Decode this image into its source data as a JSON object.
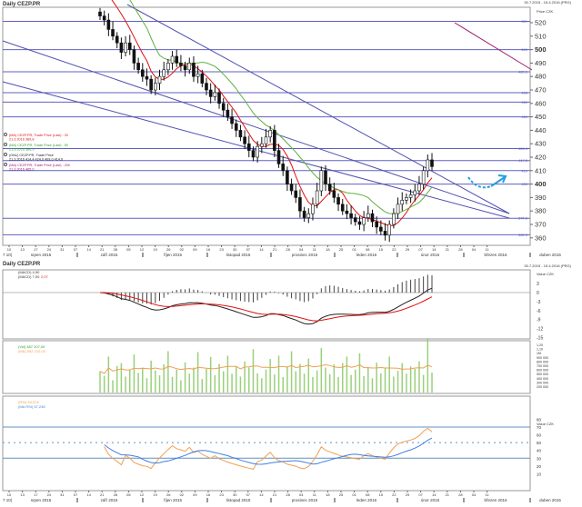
{
  "header": {
    "title": "Daily CEZP.PR",
    "date_range": "30.7.2015 - 15.4.2016 (PRG)",
    "axis_unit": "Price CZK"
  },
  "legend": [
    {
      "text": "(MA) CEZP.PR, Trade Price (Last) : 20",
      "sub": "21.3.2016  389,8",
      "color": "#e01010"
    },
    {
      "text": "(MA) CEZP.PR, Trade Price (Last) : 50",
      "sub": "21.3.2016  386,9",
      "color": "#30a030"
    },
    {
      "text": "(Ohlc) CEZP.PR, Trade Price",
      "sub": "21.3.2016  414,4  424,0  409,0  414,0",
      "color": "#202020"
    },
    {
      "text": "(MA) CEZP.PR, Trade Price (Last) : 200",
      "sub": "21.3.2016  465,0",
      "color": "#a02070"
    }
  ],
  "macd_legend": {
    "line1": "(MACD) 4,90",
    "line2": "(MACD) 7,00",
    "line2_val": "2,07"
  },
  "volume_legend": {
    "line1": "(Vol) 487 207,00",
    "line2": "(MA) 552 222,00"
  },
  "rsi_legend": {
    "line1": "(RSI) 64,578",
    "line2": "(MA RSI) 57,246"
  },
  "panel_unit": "Value CZK",
  "chart_data": [
    {
      "type": "candlestick",
      "title": "Daily CEZP.PR",
      "ylabel": "Price CZK",
      "ylim": [
        355,
        525
      ],
      "closes": [
        525,
        522,
        515,
        510,
        505,
        498,
        505,
        500,
        490,
        485,
        480,
        478,
        470,
        475,
        480,
        485,
        490,
        495,
        490,
        488,
        485,
        490,
        480,
        482,
        475,
        470,
        465,
        468,
        460,
        455,
        450,
        445,
        440,
        435,
        430,
        425,
        420,
        428,
        430,
        435,
        440,
        425,
        415,
        410,
        400,
        395,
        390,
        380,
        375,
        378,
        385,
        395,
        410,
        400,
        395,
        390,
        385,
        380,
        378,
        375,
        372,
        370,
        375,
        378,
        372,
        368,
        365,
        362,
        370,
        378,
        385,
        388,
        390,
        392,
        395,
        400,
        410,
        418,
        413
      ],
      "hlines": [
        521.0,
        500.0,
        483.5,
        468.0,
        461.0,
        450.0,
        426.4,
        417.5,
        410.0,
        400.0,
        374.6,
        362.3
      ],
      "yticks": [
        520,
        510,
        500,
        490,
        480,
        470,
        460,
        450,
        440,
        430,
        420,
        410,
        400,
        390,
        380,
        370,
        360
      ],
      "series": [
        "MA 20",
        "MA 50",
        "MA 200",
        "OHLC"
      ]
    },
    {
      "type": "line",
      "title": "MACD",
      "yticks": [
        3,
        0,
        -3,
        -6,
        -9,
        -12,
        -15
      ]
    },
    {
      "type": "bar",
      "title": "Volume",
      "values": [
        520,
        410,
        880,
        300,
        650,
        720,
        390,
        560,
        930,
        480,
        610,
        350,
        780,
        540,
        420,
        690,
        1010,
        380,
        560,
        300,
        740,
        460,
        610,
        990,
        330,
        580,
        870,
        420,
        700,
        520,
        900,
        460,
        640,
        390,
        760,
        610,
        1060,
        470,
        350,
        560,
        820,
        440,
        900,
        380,
        640,
        1010,
        520,
        700,
        460,
        830,
        380,
        540,
        1090,
        610,
        450,
        690,
        380,
        720,
        880,
        430,
        560,
        960,
        400,
        620,
        350,
        730,
        470,
        610,
        880,
        390,
        530,
        720,
        460,
        640,
        580,
        760,
        430,
        1300,
        487
      ],
      "yticks": [
        "1,20",
        "1,10",
        "1M",
        "900 000",
        "800 000",
        "700 000",
        "600 000",
        "500 000",
        "400 000",
        "300 000",
        "200 000"
      ]
    },
    {
      "type": "line",
      "title": "RSI",
      "yticks": [
        80,
        70,
        60,
        50,
        40,
        30,
        20,
        10
      ],
      "levels": [
        70,
        50,
        30
      ]
    }
  ],
  "xaxis": {
    "days": [
      "10",
      "13",
      "17",
      "24",
      "31",
      "07",
      "14",
      "21",
      "28",
      "05",
      "12",
      "19",
      "26",
      "02",
      "09",
      "16",
      "23",
      "30",
      "07",
      "14",
      "21",
      "28",
      "04",
      "11",
      "18",
      "25",
      "01",
      "08",
      "15",
      "22",
      "29",
      "07",
      "14",
      "21",
      "28",
      "04",
      "11"
    ],
    "months": [
      "srpen 2015",
      "září 2015",
      "říjen 2015",
      "listopad 2015",
      "prosinec 2015",
      "leden 2016",
      "únor 2016",
      "březen 2016",
      "duben 2016"
    ],
    "start": "7 10|"
  },
  "colors": {
    "hline": "#6060c0",
    "ma20": "#e01010",
    "ma50": "#60b040",
    "ma200": "#a02070",
    "trend": "#5050b0",
    "arrow": "#20a0e0",
    "vol": "#9ad07a",
    "volma": "#f0a050",
    "rsi": "#f0a050",
    "rsima": "#4080e0"
  }
}
